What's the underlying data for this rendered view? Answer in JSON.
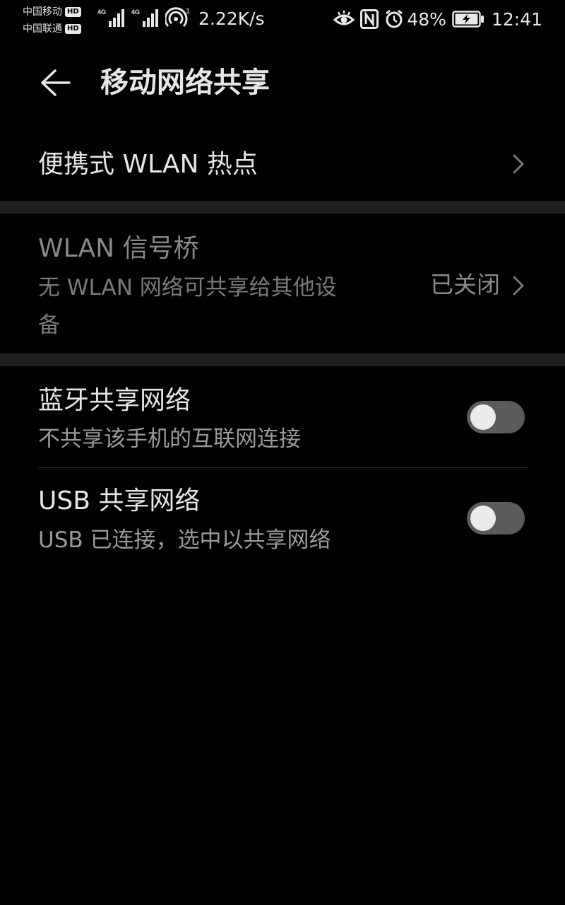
{
  "status_bar": {
    "carrier_1": "中国移动",
    "carrier_2": "中国联通",
    "hd_badge": "HD",
    "net_type_1": "4G",
    "net_type_2": "4G",
    "hotspot_count": "1",
    "network_speed": "2.22K/s",
    "battery_percent": "48%",
    "time": "12:41",
    "icons": [
      "eye-comfort-icon",
      "nfc-icon",
      "alarm-icon",
      "battery-charging-icon",
      "hotspot-icon",
      "signal-icon"
    ]
  },
  "header": {
    "title": "移动网络共享",
    "back_icon": "arrow-left-icon"
  },
  "items": {
    "hotspot": {
      "title": "便携式 WLAN 热点"
    },
    "wlan_bridge": {
      "title": "WLAN 信号桥",
      "subtitle_line1": "无 WLAN 网络可共享给其他设",
      "subtitle_line2": "备",
      "value": "已关闭"
    },
    "bluetooth_tethering": {
      "title": "蓝牙共享网络",
      "subtitle": "不共享该手机的互联网连接",
      "enabled": false
    },
    "usb_tethering": {
      "title": "USB 共享网络",
      "subtitle": "USB 已连接，选中以共享网络",
      "enabled": false
    }
  },
  "colors": {
    "background": "#000000",
    "section_band": "#1f1f1f",
    "toggle_track_off": "#5b5b5b",
    "toggle_knob": "#ebebeb"
  }
}
